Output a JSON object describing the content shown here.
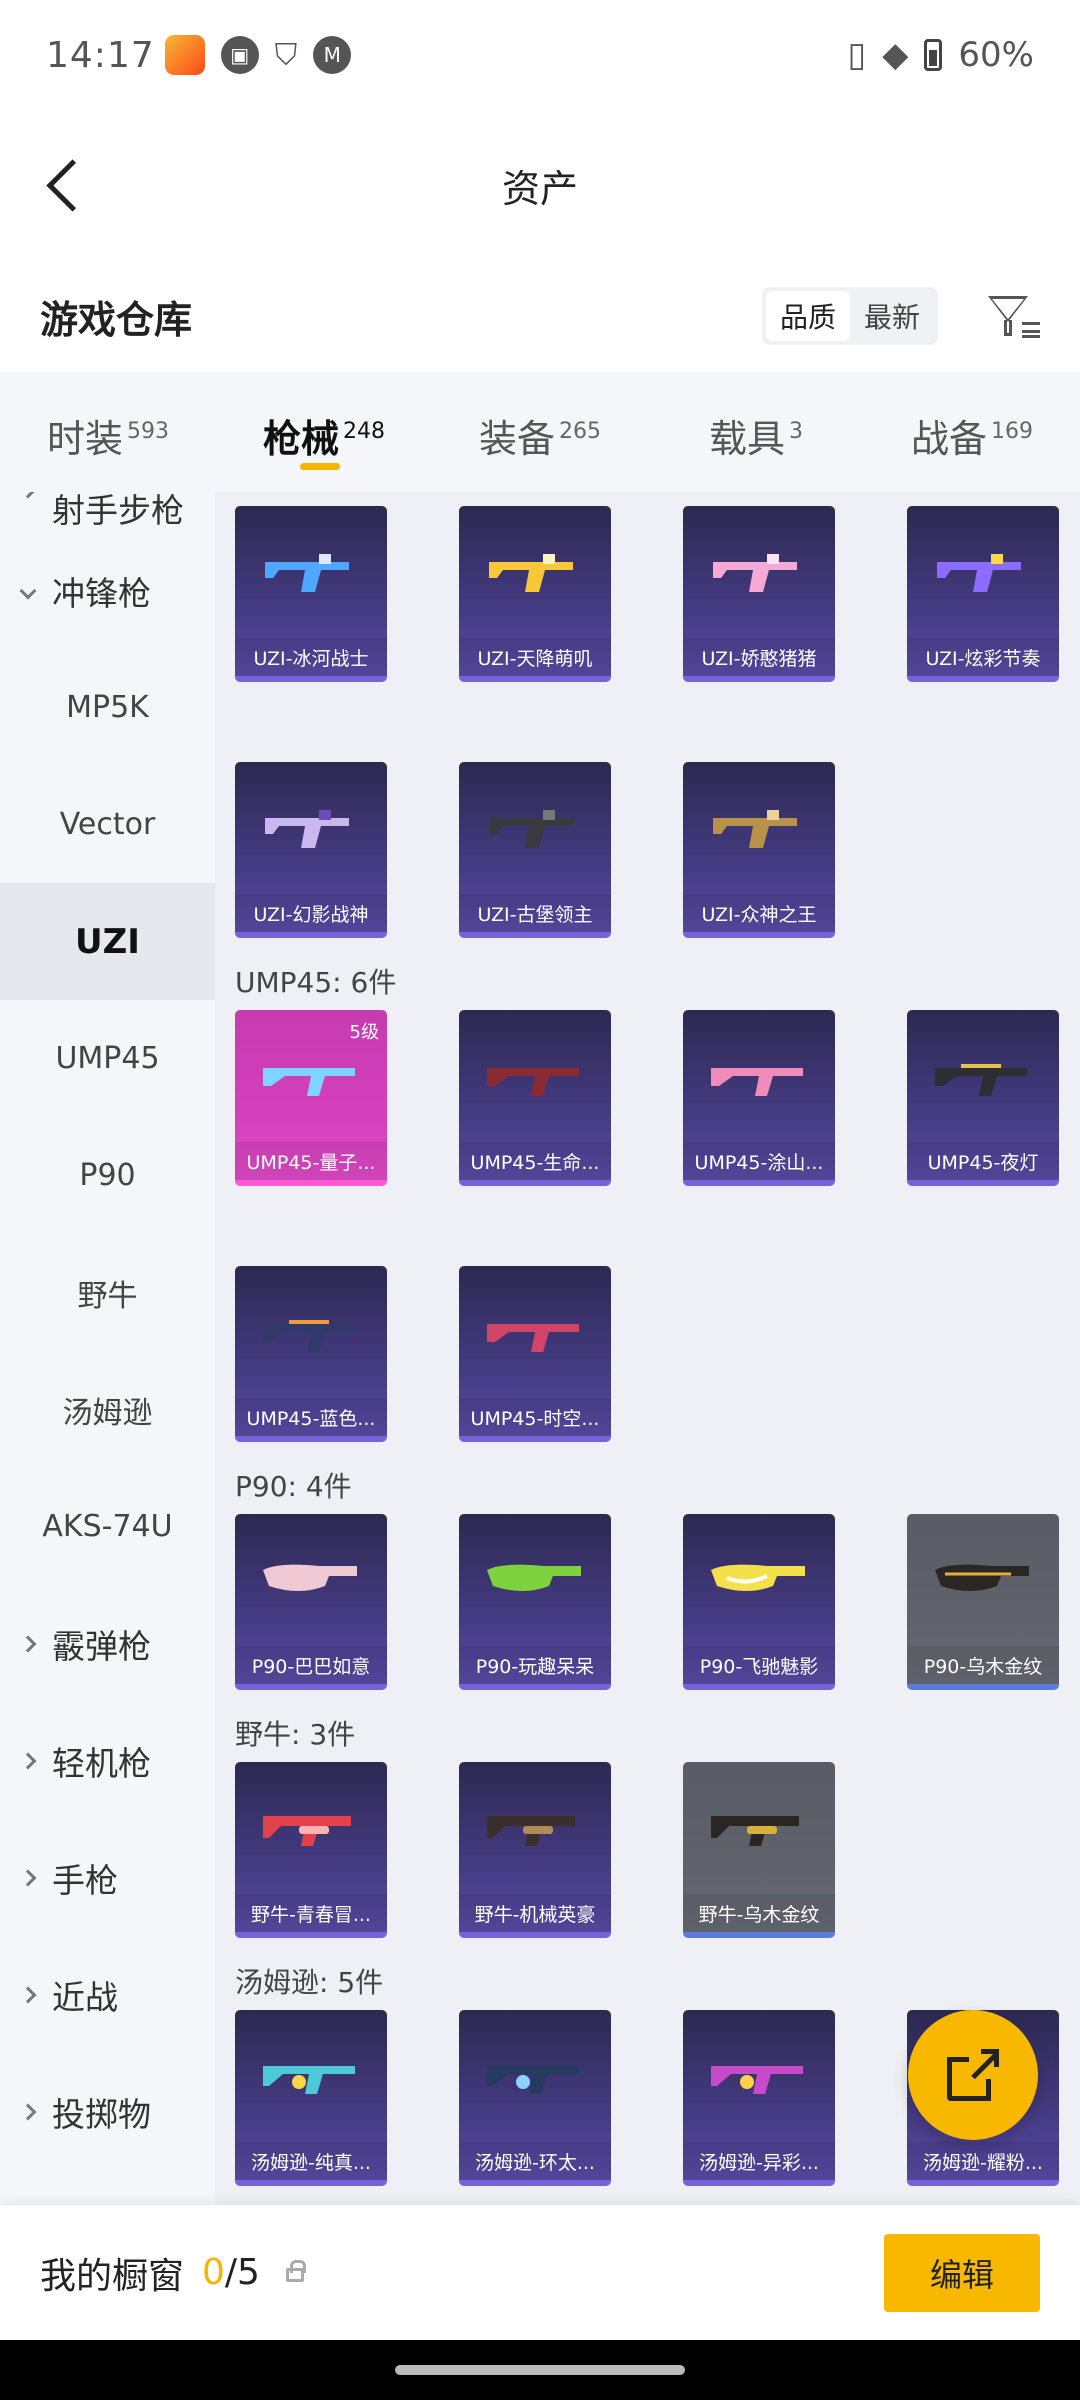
{
  "status": {
    "time": "14:17",
    "battery": "60%"
  },
  "header": {
    "title": "资产"
  },
  "warehouse": {
    "title": "游戏仓库",
    "sort_quality": "品质",
    "sort_newest": "最新"
  },
  "tabs": [
    {
      "label": "时装",
      "count": "593"
    },
    {
      "label": "枪械",
      "count": "248"
    },
    {
      "label": "装备",
      "count": "265"
    },
    {
      "label": "载具",
      "count": "3"
    },
    {
      "label": "战备",
      "count": "169"
    }
  ],
  "sidebar": {
    "items": [
      "射手步枪",
      "冲锋枪",
      "MP5K",
      "Vector",
      "UZI",
      "UMP45",
      "P90",
      "野牛",
      "汤姆逊",
      "AKS-74U",
      "霰弹枪",
      "轻机枪",
      "手枪",
      "近战",
      "投掷物"
    ]
  },
  "groups": {
    "uzi": {
      "items": [
        "UZI-冰河战士",
        "UZI-天降萌叽",
        "UZI-娇憨猪猪",
        "UZI-炫彩节奏",
        "UZI-幻影战神",
        "UZI-古堡领主",
        "UZI-众神之王"
      ]
    },
    "ump45": {
      "title": "UMP45: 6件",
      "level": "5级",
      "items": [
        "UMP45-量子...",
        "UMP45-生命...",
        "UMP45-涂山...",
        "UMP45-夜灯",
        "UMP45-蓝色...",
        "UMP45-时空..."
      ]
    },
    "p90": {
      "title": "P90: 4件",
      "items": [
        "P90-巴巴如意",
        "P90-玩趣呆呆",
        "P90-飞驰魅影",
        "P90-乌木金纹"
      ]
    },
    "bison": {
      "title": "野牛: 3件",
      "items": [
        "野牛-青春冒...",
        "野牛-机械英豪",
        "野牛-乌木金纹"
      ]
    },
    "thompson": {
      "title": "汤姆逊: 5件",
      "items": [
        "汤姆逊-纯真...",
        "汤姆逊-环太...",
        "汤姆逊-异彩...",
        "汤姆逊-耀粉..."
      ]
    }
  },
  "bottom": {
    "my_window": "我的橱窗",
    "current": "0",
    "total": "/5",
    "edit": "编辑"
  },
  "colors": {
    "accent": "#f9b800",
    "card_purple": "#473c86",
    "card_pink": "#d43fbd",
    "card_gray": "#5f626b"
  }
}
